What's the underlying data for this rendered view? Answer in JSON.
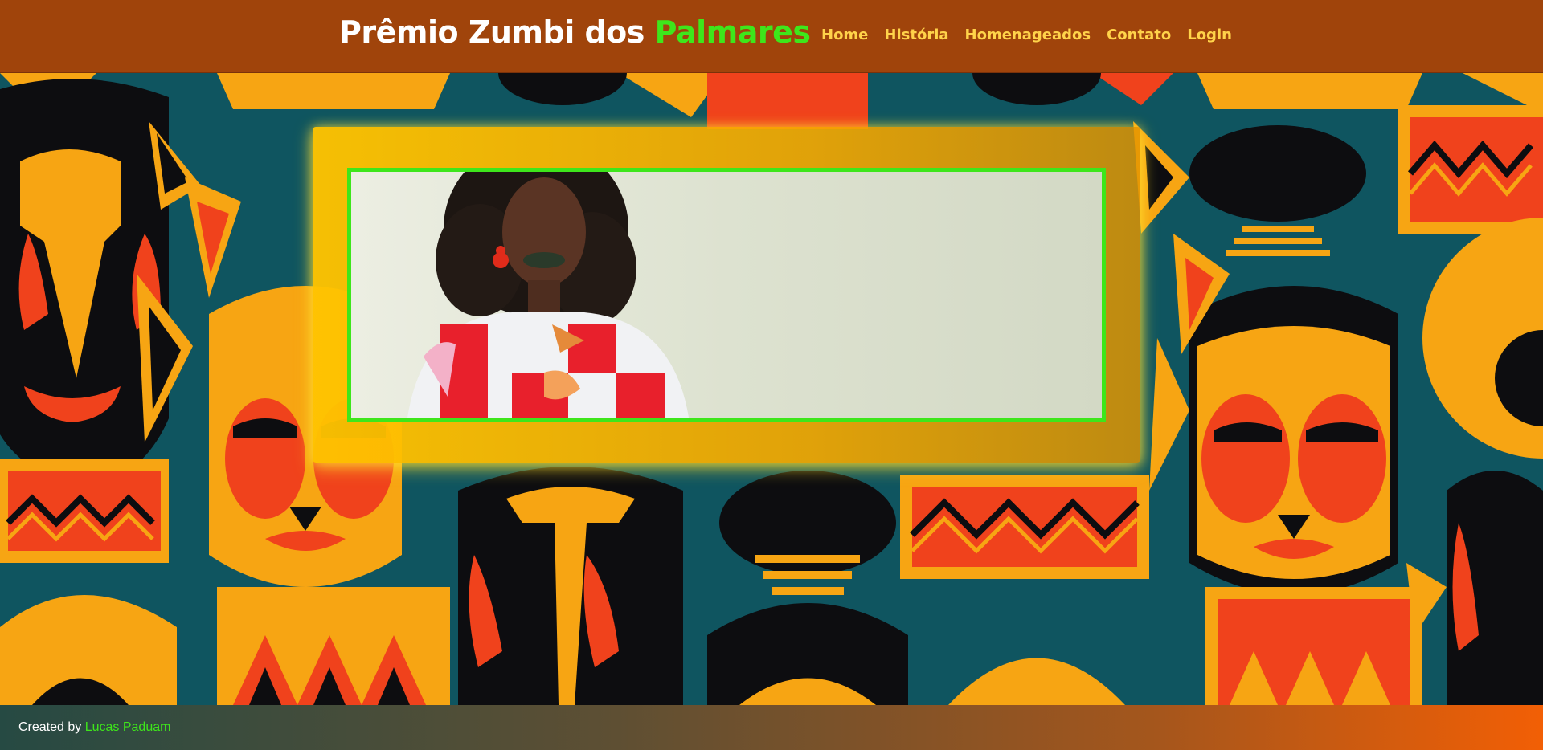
{
  "header": {
    "brand_main": "Prêmio Zumbi dos ",
    "brand_accent": "Palmares",
    "nav": [
      "Home",
      "História",
      "Homenageados",
      "Contato",
      "Login"
    ]
  },
  "footer": {
    "prefix": "Created by ",
    "author": "Lucas Paduam"
  },
  "colors": {
    "header_bg": "#a0440b",
    "accent_green": "#3ee61b",
    "nav_yellow": "#ffd34a",
    "panel_yellow": "#ffc400",
    "pattern_teal": "#0f5560",
    "pattern_orange": "#f7a513",
    "pattern_red": "#f0421c",
    "pattern_black": "#0d0d10"
  },
  "icons": {
    "background": "african-mask-pattern",
    "hero": "woman-portrait-photo"
  }
}
